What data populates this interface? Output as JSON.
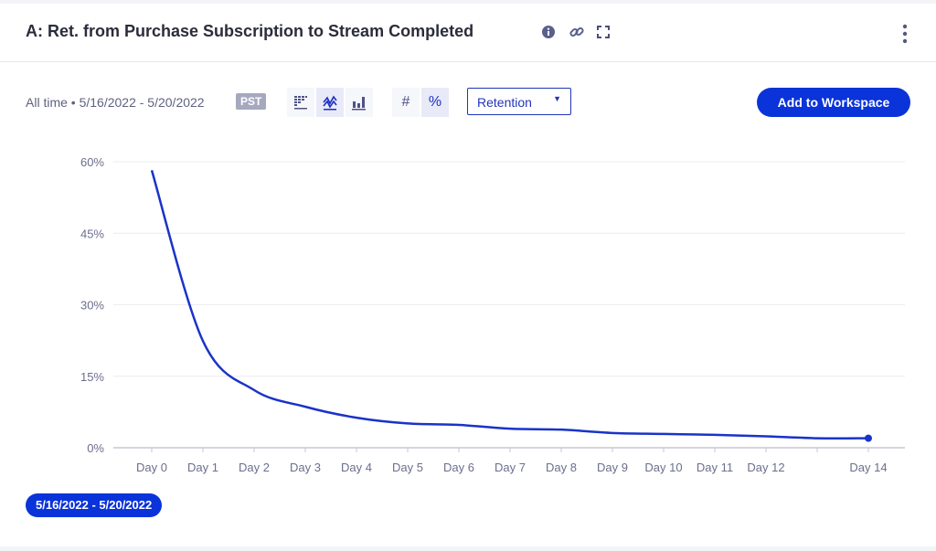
{
  "header": {
    "title": "A: Ret. from Purchase Subscription to Stream Completed",
    "icons": [
      "info-icon",
      "link-icon",
      "expand-icon",
      "more-vertical-icon"
    ]
  },
  "toolbar": {
    "date_range": "All time • 5/16/2022 - 5/20/2022",
    "timezone": "PST",
    "view_buttons": [
      {
        "icon": "grid-table-icon",
        "active": false
      },
      {
        "icon": "line-chart-icon",
        "active": true
      },
      {
        "icon": "bar-chart-icon",
        "active": false
      }
    ],
    "value_buttons": [
      {
        "label": "#",
        "active": false
      },
      {
        "label": "%",
        "active": true
      }
    ],
    "metric_select": "Retention",
    "add_button": "Add to Workspace"
  },
  "colors": {
    "accent": "#0a33d9",
    "line": "#1a33c8"
  },
  "chart_data": {
    "type": "line",
    "x": [
      0,
      1,
      2,
      3,
      4,
      5,
      6,
      7,
      8,
      9,
      10,
      11,
      12,
      13,
      14
    ],
    "x_tick_labels": [
      "Day 0",
      "Day 1",
      "Day 2",
      "Day 3",
      "Day 4",
      "Day 5",
      "Day 6",
      "Day 7",
      "Day 8",
      "Day 9",
      "Day 10",
      "Day 11",
      "Day 12",
      "",
      "Day 14"
    ],
    "series": [
      {
        "name": "5/16/2022 - 5/20/2022",
        "values": [
          58.2,
          22.4,
          12.1,
          8.6,
          6.3,
          5.1,
          4.8,
          4.0,
          3.8,
          3.1,
          2.9,
          2.7,
          2.4,
          2.0,
          2.0
        ]
      }
    ],
    "y_ticks": [
      "0%",
      "15%",
      "30%",
      "45%",
      "60%"
    ],
    "ylim": [
      0,
      60
    ],
    "y_unit": "%",
    "grid": true,
    "legend": "bottom-left"
  }
}
